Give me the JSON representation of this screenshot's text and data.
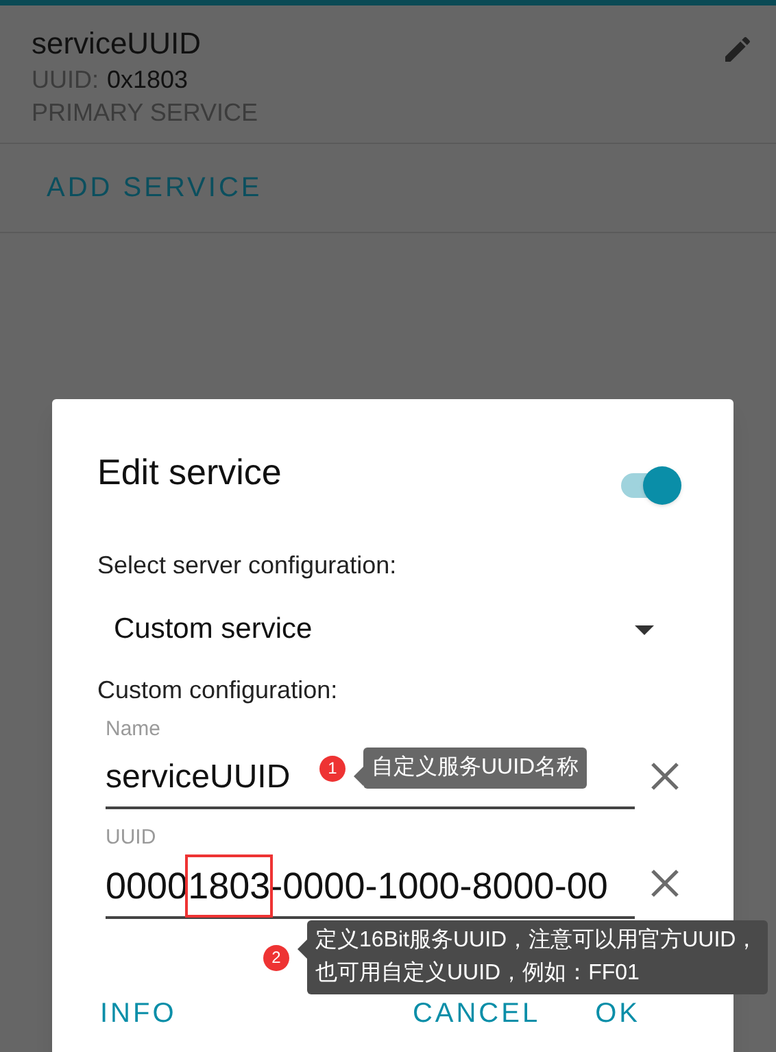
{
  "service": {
    "name": "serviceUUID",
    "uuid_label": "UUID:",
    "uuid_value": "0x1803",
    "type": "PRIMARY SERVICE"
  },
  "add_service_button": "ADD SERVICE",
  "dialog": {
    "title": "Edit service",
    "switch_on": true,
    "config_label": "Select server configuration:",
    "dropdown": {
      "value": "Custom service"
    },
    "custom_label": "Custom configuration:",
    "name_field": {
      "label": "Name",
      "value": "serviceUUID"
    },
    "uuid_field": {
      "label": "UUID",
      "value_parts": [
        "0000",
        "1803",
        "-0000-1000-8000-00"
      ]
    },
    "buttons": [
      {
        "label": "INFO",
        "kind": "left"
      },
      {
        "label": "CANCEL",
        "kind": "right"
      },
      {
        "label": "OK",
        "kind": "right"
      }
    ]
  },
  "annotations": [
    {
      "number": "1",
      "text": "自定义服务UUID名称"
    },
    {
      "number": "2",
      "text": "定义16Bit服务UUID，注意可以用官方UUID，也可用自定义UUID，例如：FF01"
    }
  ]
}
